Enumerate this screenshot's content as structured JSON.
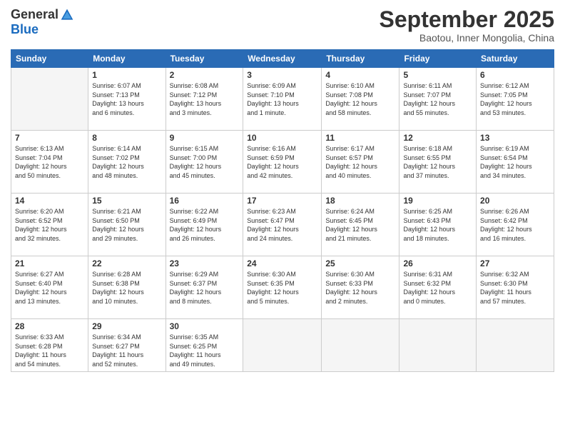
{
  "logo": {
    "general": "General",
    "blue": "Blue"
  },
  "title": "September 2025",
  "subtitle": "Baotou, Inner Mongolia, China",
  "headers": [
    "Sunday",
    "Monday",
    "Tuesday",
    "Wednesday",
    "Thursday",
    "Friday",
    "Saturday"
  ],
  "weeks": [
    [
      {
        "day": "",
        "info": ""
      },
      {
        "day": "1",
        "info": "Sunrise: 6:07 AM\nSunset: 7:13 PM\nDaylight: 13 hours\nand 6 minutes."
      },
      {
        "day": "2",
        "info": "Sunrise: 6:08 AM\nSunset: 7:12 PM\nDaylight: 13 hours\nand 3 minutes."
      },
      {
        "day": "3",
        "info": "Sunrise: 6:09 AM\nSunset: 7:10 PM\nDaylight: 13 hours\nand 1 minute."
      },
      {
        "day": "4",
        "info": "Sunrise: 6:10 AM\nSunset: 7:08 PM\nDaylight: 12 hours\nand 58 minutes."
      },
      {
        "day": "5",
        "info": "Sunrise: 6:11 AM\nSunset: 7:07 PM\nDaylight: 12 hours\nand 55 minutes."
      },
      {
        "day": "6",
        "info": "Sunrise: 6:12 AM\nSunset: 7:05 PM\nDaylight: 12 hours\nand 53 minutes."
      }
    ],
    [
      {
        "day": "7",
        "info": "Sunrise: 6:13 AM\nSunset: 7:04 PM\nDaylight: 12 hours\nand 50 minutes."
      },
      {
        "day": "8",
        "info": "Sunrise: 6:14 AM\nSunset: 7:02 PM\nDaylight: 12 hours\nand 48 minutes."
      },
      {
        "day": "9",
        "info": "Sunrise: 6:15 AM\nSunset: 7:00 PM\nDaylight: 12 hours\nand 45 minutes."
      },
      {
        "day": "10",
        "info": "Sunrise: 6:16 AM\nSunset: 6:59 PM\nDaylight: 12 hours\nand 42 minutes."
      },
      {
        "day": "11",
        "info": "Sunrise: 6:17 AM\nSunset: 6:57 PM\nDaylight: 12 hours\nand 40 minutes."
      },
      {
        "day": "12",
        "info": "Sunrise: 6:18 AM\nSunset: 6:55 PM\nDaylight: 12 hours\nand 37 minutes."
      },
      {
        "day": "13",
        "info": "Sunrise: 6:19 AM\nSunset: 6:54 PM\nDaylight: 12 hours\nand 34 minutes."
      }
    ],
    [
      {
        "day": "14",
        "info": "Sunrise: 6:20 AM\nSunset: 6:52 PM\nDaylight: 12 hours\nand 32 minutes."
      },
      {
        "day": "15",
        "info": "Sunrise: 6:21 AM\nSunset: 6:50 PM\nDaylight: 12 hours\nand 29 minutes."
      },
      {
        "day": "16",
        "info": "Sunrise: 6:22 AM\nSunset: 6:49 PM\nDaylight: 12 hours\nand 26 minutes."
      },
      {
        "day": "17",
        "info": "Sunrise: 6:23 AM\nSunset: 6:47 PM\nDaylight: 12 hours\nand 24 minutes."
      },
      {
        "day": "18",
        "info": "Sunrise: 6:24 AM\nSunset: 6:45 PM\nDaylight: 12 hours\nand 21 minutes."
      },
      {
        "day": "19",
        "info": "Sunrise: 6:25 AM\nSunset: 6:43 PM\nDaylight: 12 hours\nand 18 minutes."
      },
      {
        "day": "20",
        "info": "Sunrise: 6:26 AM\nSunset: 6:42 PM\nDaylight: 12 hours\nand 16 minutes."
      }
    ],
    [
      {
        "day": "21",
        "info": "Sunrise: 6:27 AM\nSunset: 6:40 PM\nDaylight: 12 hours\nand 13 minutes."
      },
      {
        "day": "22",
        "info": "Sunrise: 6:28 AM\nSunset: 6:38 PM\nDaylight: 12 hours\nand 10 minutes."
      },
      {
        "day": "23",
        "info": "Sunrise: 6:29 AM\nSunset: 6:37 PM\nDaylight: 12 hours\nand 8 minutes."
      },
      {
        "day": "24",
        "info": "Sunrise: 6:30 AM\nSunset: 6:35 PM\nDaylight: 12 hours\nand 5 minutes."
      },
      {
        "day": "25",
        "info": "Sunrise: 6:30 AM\nSunset: 6:33 PM\nDaylight: 12 hours\nand 2 minutes."
      },
      {
        "day": "26",
        "info": "Sunrise: 6:31 AM\nSunset: 6:32 PM\nDaylight: 12 hours\nand 0 minutes."
      },
      {
        "day": "27",
        "info": "Sunrise: 6:32 AM\nSunset: 6:30 PM\nDaylight: 11 hours\nand 57 minutes."
      }
    ],
    [
      {
        "day": "28",
        "info": "Sunrise: 6:33 AM\nSunset: 6:28 PM\nDaylight: 11 hours\nand 54 minutes."
      },
      {
        "day": "29",
        "info": "Sunrise: 6:34 AM\nSunset: 6:27 PM\nDaylight: 11 hours\nand 52 minutes."
      },
      {
        "day": "30",
        "info": "Sunrise: 6:35 AM\nSunset: 6:25 PM\nDaylight: 11 hours\nand 49 minutes."
      },
      {
        "day": "",
        "info": ""
      },
      {
        "day": "",
        "info": ""
      },
      {
        "day": "",
        "info": ""
      },
      {
        "day": "",
        "info": ""
      }
    ]
  ]
}
